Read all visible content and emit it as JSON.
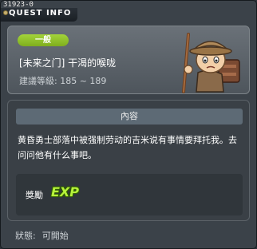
{
  "window": {
    "quest_id": "31923-0",
    "title": "QUEST INFO"
  },
  "header": {
    "category": "一般",
    "quest_name": "[未来之门] 干渴的喉咙",
    "level_label": "建議等級: 185 ~ 189"
  },
  "content": {
    "section_title": "內容",
    "description": "黄昏勇士部落中被强制劳动的吉米说有事情要拜托我。去问问他有什么事吧。"
  },
  "reward": {
    "label": "獎勵",
    "icon": "EXP"
  },
  "status": {
    "label": "狀態:",
    "value": "可開始"
  },
  "colors": {
    "badge": "#8fc22a",
    "exp": "#b6f23a"
  }
}
